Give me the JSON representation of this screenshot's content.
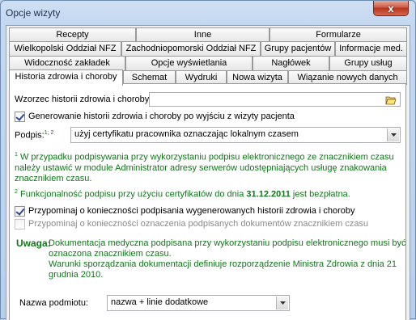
{
  "window": {
    "title": "Opcje wizyty",
    "close_glyph": "x"
  },
  "tabs": {
    "row1": [
      "Recepty",
      "Inne",
      "Formularze"
    ],
    "row2": [
      "Wielkopolski Oddział NFZ",
      "Zachodniopomorski Oddział NFZ",
      "Grupy pacjentów",
      "Informacje med."
    ],
    "row3": [
      "Widoczność zakładek",
      "Opcje wyświetlania",
      "Nagłówek",
      "Grupy usług"
    ],
    "row4": [
      "Historia zdrowia i choroby",
      "Schemat",
      "Wydruki",
      "Nowa wizyta",
      "Wiązanie nowych danych"
    ],
    "active": "Historia zdrowia i choroby"
  },
  "form": {
    "template_label": "Wzorzec historii zdrowia i choroby:",
    "template_value": "",
    "generate_label": "Generowanie historii zdrowia i choroby po wyjściu z wizyty pacjenta",
    "generate_checked": true,
    "signature_label": "Podpis:",
    "signature_sup": "1; 2",
    "signature_value": "użyj certyfikatu pracownika oznaczając lokalnym czasem",
    "note1_sup": "1",
    "note1_text": "W przypadku podpisywania przy wykorzystaniu podpisu elektronicznego ze znacznikiem czasu należy ustawić w module Administrator adresy serwerów udostępniających usługę znakowania znacznikiem czasu.",
    "note2_sup": "2",
    "note2_text_before": "Funkcjonalność podpisu przy użyciu certyfikatów do dnia",
    "note2_date": "31.12.2011",
    "note2_text_after": "jest bezpłatna.",
    "remind_sign_label": "Przypominaj o konieczności podpisania wygenerowanych historii zdrowia i choroby",
    "remind_sign_checked": true,
    "remind_timestamp_label": "Przypominaj o konieczności oznaczenia podpisanych dokumentów znacznikiem czasu",
    "remind_timestamp_checked": false,
    "warning_label": "Uwaga:",
    "warning_line1": "Dokumentacja medyczna podpisana przy wykorzystaniu podpisu elektronicznego musi być",
    "warning_line2": "oznaczona znacznikiem czasu.",
    "warning_line3": "Warunki sporządzania dokumentacji definiuje rozporządzenie Ministra Zdrowia z dnia 21",
    "warning_line4": "grudnia 2010.",
    "entity_label": "Nazwa podmiotu:",
    "entity_value": "nazwa + linie dodatkowe"
  },
  "colors": {
    "note": "#11771a",
    "disabled": "#8a8a8a"
  }
}
